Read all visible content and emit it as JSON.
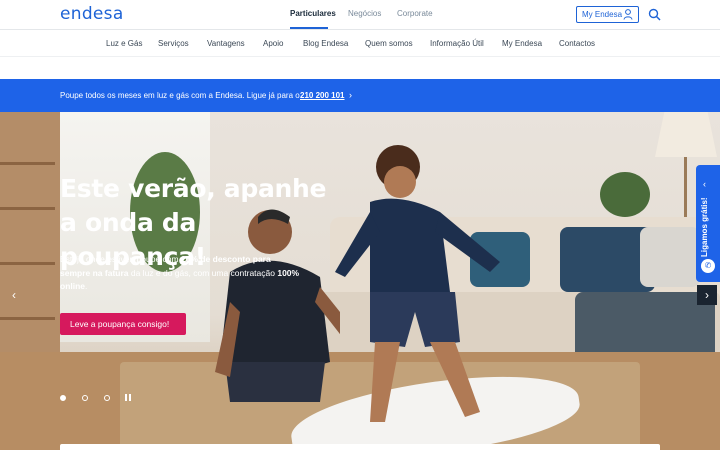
{
  "header": {
    "logo": "endesa",
    "segments": [
      "Particulares",
      "Negócios",
      "Corporate"
    ],
    "my_endesa": "My Endesa"
  },
  "nav": [
    "Luz e Gás",
    "Serviços",
    "Vantagens",
    "Apoio",
    "Blog Endesa",
    "Quem somos",
    "Informação Útil",
    "My Endesa",
    "Contactos"
  ],
  "banner": {
    "text": "Poupe todos os meses em luz e gás com a Endesa. Ligue já para o",
    "phone": "210 200 101"
  },
  "hero": {
    "title": "Este verão, apanhe a onda da poupança!",
    "text_1": "Esteja onde estiver, poupe com ",
    "text_bold_1": "20% de desconto para sempre na fatura",
    "text_2": " da luz e do gás, com uma contratação ",
    "text_bold_2": "100% online",
    "text_3": ".",
    "cta": "Leve a poupança consigo!"
  },
  "side_tab": {
    "label": "Ligamos grátis!"
  },
  "icons": {
    "user": "user-icon",
    "search": "search-icon",
    "chevron": "chevron-right-icon",
    "phone": "phone-icon",
    "pause": "pause-icon"
  },
  "colors": {
    "brand_blue": "#1e63e8",
    "cta_pink": "#d6195d"
  }
}
